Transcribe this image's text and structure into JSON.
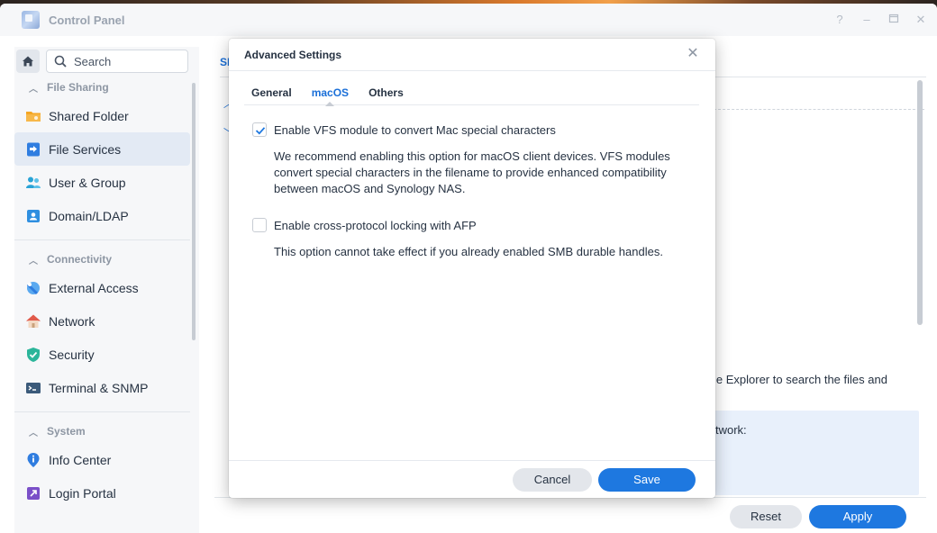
{
  "window": {
    "title": "Control Panel"
  },
  "sidebar": {
    "search_placeholder": "Search",
    "sections": [
      {
        "title": "File Sharing",
        "items": [
          {
            "label": "Shared Folder",
            "icon": "folder-icon",
            "color": "#f5a623"
          },
          {
            "label": "File Services",
            "icon": "file-services-icon",
            "color": "#2f7de0",
            "active": true
          },
          {
            "label": "User & Group",
            "icon": "user-group-icon",
            "color": "#29a3d6"
          },
          {
            "label": "Domain/LDAP",
            "icon": "domain-icon",
            "color": "#2f8fe0"
          }
        ]
      },
      {
        "title": "Connectivity",
        "items": [
          {
            "label": "External Access",
            "icon": "external-access-icon",
            "color": "#2f8fe0"
          },
          {
            "label": "Network",
            "icon": "network-house-icon",
            "color": "#e15a4a"
          },
          {
            "label": "Security",
            "icon": "shield-icon",
            "color": "#2bb59a"
          },
          {
            "label": "Terminal & SNMP",
            "icon": "terminal-icon",
            "color": "#3b5a7a"
          }
        ]
      },
      {
        "title": "System",
        "items": [
          {
            "label": "Info Center",
            "icon": "info-icon",
            "color": "#2f7de0"
          },
          {
            "label": "Login Portal",
            "icon": "login-portal-icon",
            "color": "#7a4fc8"
          }
        ]
      }
    ]
  },
  "main": {
    "tab_partial": "SI",
    "partial_text": "le Explorer to search the files and",
    "info_partial": "twork:",
    "reset_label": "Reset",
    "apply_label": "Apply"
  },
  "modal": {
    "title": "Advanced Settings",
    "tabs": [
      {
        "label": "General",
        "active": false
      },
      {
        "label": "macOS",
        "active": true
      },
      {
        "label": "Others",
        "active": false
      }
    ],
    "options": [
      {
        "label": "Enable VFS module to convert Mac special characters",
        "checked": true,
        "description": "We recommend enabling this option for macOS client devices. VFS modules convert special characters in the filename to provide enhanced compatibility between macOS and Synology NAS."
      },
      {
        "label": "Enable cross-protocol locking with AFP",
        "checked": false,
        "description": "This option cannot take effect if you already enabled SMB durable handles."
      }
    ],
    "cancel_label": "Cancel",
    "save_label": "Save"
  },
  "colors": {
    "accent": "#1e78e0",
    "active_tab": "#1a6fd8",
    "sidebar_active": "#e3eaf4"
  }
}
